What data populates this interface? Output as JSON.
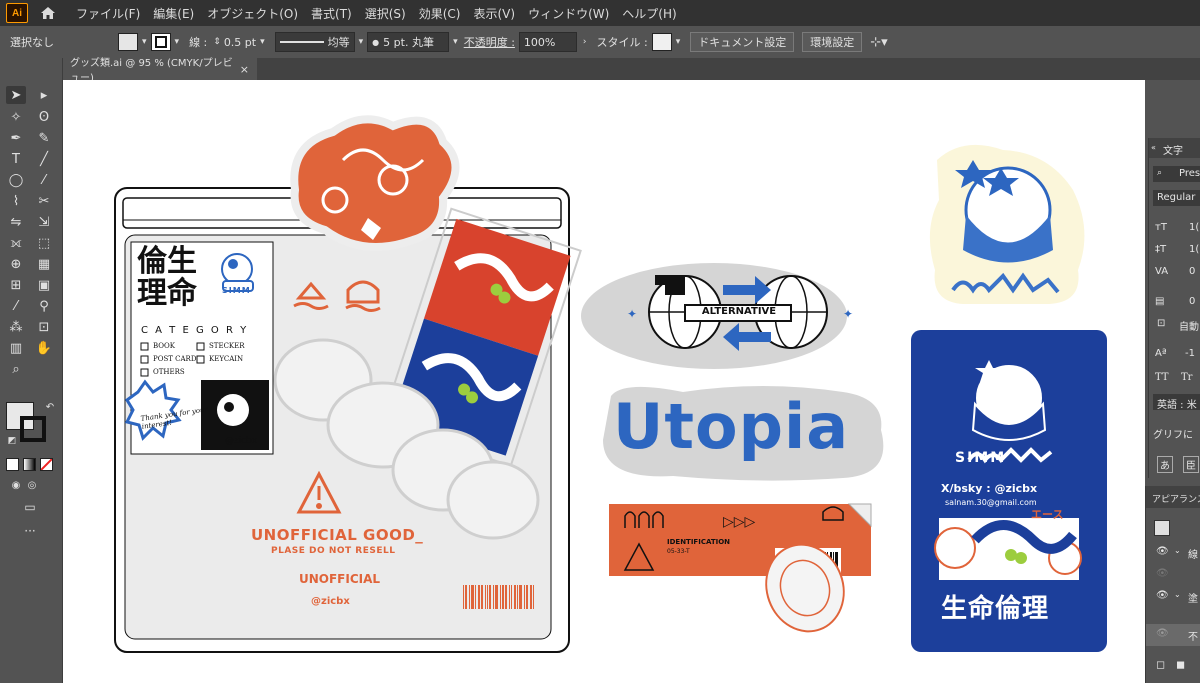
{
  "app": {
    "logo": "Ai",
    "icon": "home-icon"
  },
  "menu": [
    "ファイル(F)",
    "編集(E)",
    "オブジェクト(O)",
    "書式(T)",
    "選択(S)",
    "効果(C)",
    "表示(V)",
    "ウィンドウ(W)",
    "ヘルプ(H)"
  ],
  "control": {
    "selection": "選択なし",
    "stroke_label": "線 :",
    "stroke_value": "0.5 pt",
    "profile": "均等",
    "brush": "5 pt. 丸筆",
    "opacity_label": "不透明度 :",
    "opacity_value": "100%",
    "style_label": "スタイル :",
    "doc_setup": "ドキュメント設定",
    "prefs": "環境設定"
  },
  "doc_tab": {
    "title": "グッズ類.ai @ 95 % (CMYK/プレビュー)",
    "close": "×"
  },
  "panel_char": {
    "tab": "文字",
    "font_search": "Pres",
    "style": "Regular",
    "size": "1(",
    "leading": "1(",
    "tracking": "0",
    "kerning": "0",
    "auto": "自動",
    "baseline": "-1",
    "tt1": "TT",
    "tt2": "Tr",
    "lang": "英語 : 米",
    "glyph": "グリフに",
    "icon_a": "あ",
    "icon_b": "臣"
  },
  "panel_appearance": {
    "title": "アピアランス",
    "r1": "線",
    "r2": "塗",
    "r3": "不"
  },
  "artwork": {
    "card_title_a": "倫生",
    "card_title_b": "理命",
    "category": "C A T E G O R Y",
    "checks": [
      "BOOK",
      "STECKER",
      "POST CARD",
      "KEYCAIN",
      "OTHERS"
    ],
    "thanks": "Thank you for your interest!",
    "handle": "@zicbx",
    "unofficial_goods": "UNOFFICIAL GOOD_",
    "please": "PLASE DO NOT RESELL",
    "unofficial": "UNOFFICIAL",
    "handle2": "@zicbx",
    "alternative": "ALTERNATIVE",
    "utopia": "Utopia",
    "ident": "IDENTIFICATION",
    "ident_code": "05-33-T",
    "arrows": "▷▷▷",
    "logo_word": "SIMM",
    "social": "X/bsky : @zicbx",
    "mail": "salnam.30@gmail.com",
    "card_jp": "生命倫理",
    "tag_jp": "エース"
  },
  "colors": {
    "orange": "#e0643a",
    "blue": "#1c3f9b",
    "blue_light": "#3a72c8",
    "green": "#9ccd3e",
    "cream": "#fbf6da",
    "grey": "#d5d5d5"
  }
}
